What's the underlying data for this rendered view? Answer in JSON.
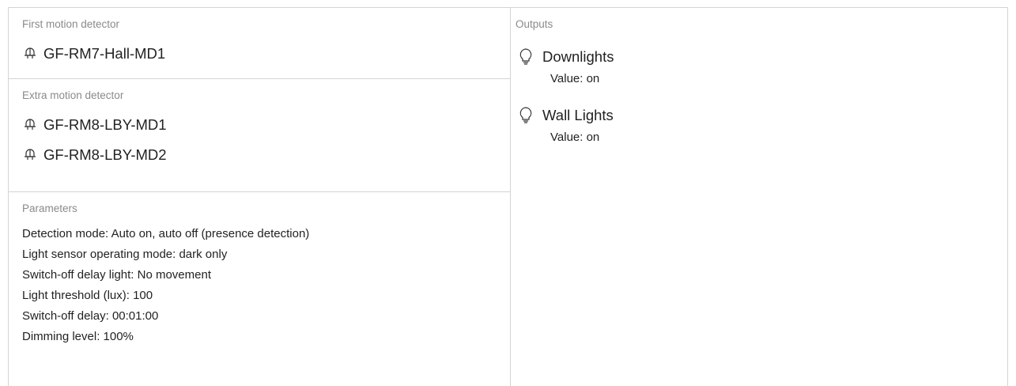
{
  "left": {
    "first_motion": {
      "title": "First motion detector",
      "devices": [
        {
          "name": "GF-RM7-Hall-MD1",
          "icon": "motion-detector-icon"
        }
      ]
    },
    "extra_motion": {
      "title": "Extra motion detector",
      "devices": [
        {
          "name": "GF-RM8-LBY-MD1",
          "icon": "motion-detector-icon"
        },
        {
          "name": "GF-RM8-LBY-MD2",
          "icon": "motion-detector-icon"
        }
      ]
    },
    "parameters": {
      "title": "Parameters",
      "items": [
        "Detection mode: Auto on, auto off (presence detection)",
        "Light sensor operating mode: dark only",
        "Switch-off delay light: No movement",
        "Light threshold (lux): 100",
        "Switch-off delay: 00:01:00",
        "Dimming level: 100%"
      ]
    }
  },
  "right": {
    "outputs": {
      "title": "Outputs",
      "items": [
        {
          "name": "Downlights",
          "value": "Value: on",
          "icon": "light-bulb-icon"
        },
        {
          "name": "Wall Lights",
          "value": "Value: on",
          "icon": "light-bulb-icon"
        }
      ]
    }
  },
  "colors": {
    "border": "#d4d4d4",
    "title_text": "#8a8a8a",
    "body_text": "#222222"
  }
}
